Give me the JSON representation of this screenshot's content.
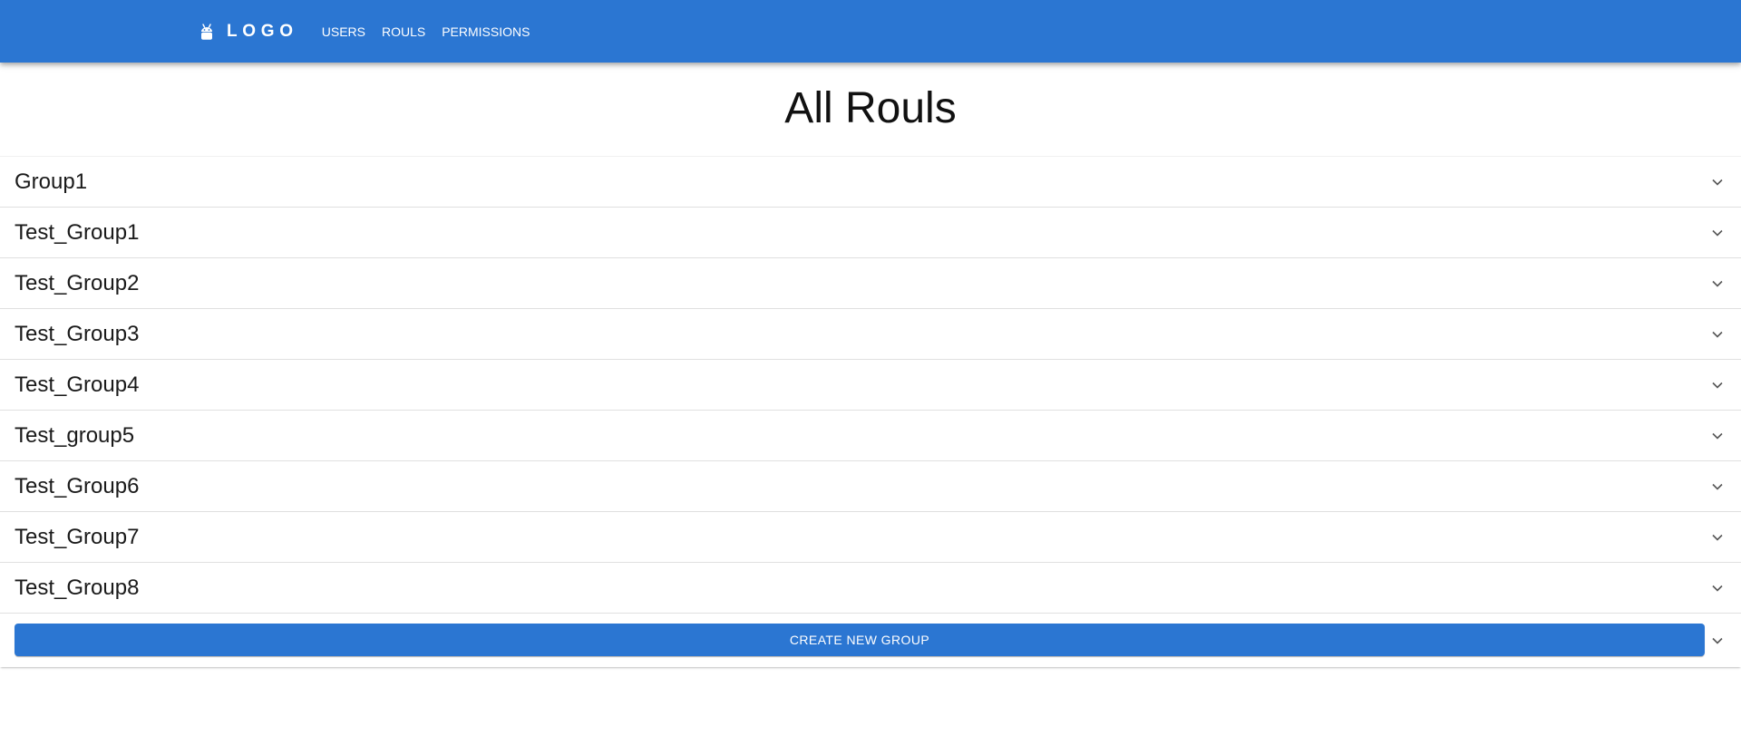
{
  "header": {
    "logo_icon": "android-icon",
    "logo_text": "LOGO",
    "nav": [
      {
        "label": "USERS"
      },
      {
        "label": "ROULS"
      },
      {
        "label": "PERMISSIONS"
      }
    ],
    "color": "#2b76d2"
  },
  "page": {
    "title": "All Rouls"
  },
  "groups": [
    {
      "name": "Group1"
    },
    {
      "name": "Test_Group1"
    },
    {
      "name": "Test_Group2"
    },
    {
      "name": "Test_Group3"
    },
    {
      "name": "Test_Group4"
    },
    {
      "name": "Test_group5"
    },
    {
      "name": "Test_Group6"
    },
    {
      "name": "Test_Group7"
    },
    {
      "name": "Test_Group8"
    }
  ],
  "actions": {
    "create_label": "CREATE NEW GROUP",
    "expand_icon": "chevron-down-icon"
  }
}
